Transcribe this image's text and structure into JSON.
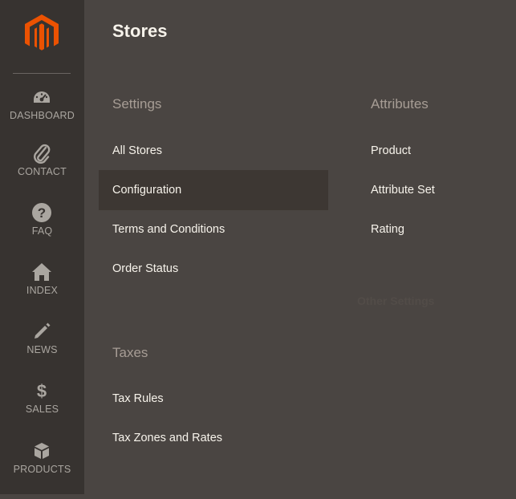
{
  "page": {
    "title": "Stores"
  },
  "colors": {
    "brand": "#eb5202",
    "sidebar": "#373330",
    "panel": "#4a4542"
  },
  "sidebar": {
    "logo_icon": "magento-logo",
    "items": [
      {
        "label": "DASHBOARD",
        "icon": "dashboard-icon"
      },
      {
        "label": "CONTACT",
        "icon": "paperclip-icon"
      },
      {
        "label": "FAQ",
        "icon": "question-icon"
      },
      {
        "label": "INDEX",
        "icon": "home-icon"
      },
      {
        "label": "NEWS",
        "icon": "pencil-icon"
      },
      {
        "label": "SALES",
        "icon": "dollar-icon"
      },
      {
        "label": "PRODUCTS",
        "icon": "cube-icon"
      }
    ]
  },
  "settings": {
    "title": "Settings",
    "items": [
      "All Stores",
      "Configuration",
      "Terms and Conditions",
      "Order Status"
    ]
  },
  "taxes": {
    "title": "Taxes",
    "items": [
      "Tax Rules",
      "Tax Zones and Rates"
    ]
  },
  "attributes": {
    "title": "Attributes",
    "items": [
      "Product",
      "Attribute Set",
      "Rating"
    ]
  },
  "other_settings": {
    "title": "Other Settings"
  }
}
